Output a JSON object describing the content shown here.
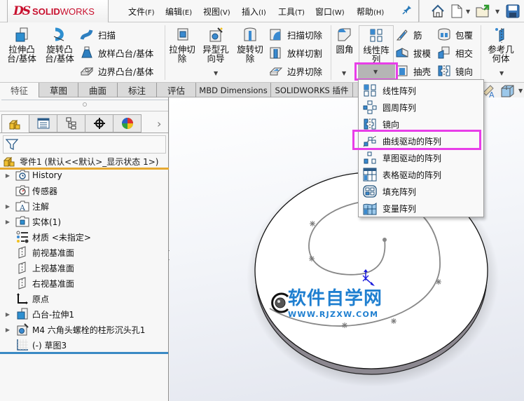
{
  "app": {
    "logo_prefix": "DS",
    "logo_bold": "SOLID",
    "logo_light": "WORKS"
  },
  "menu": [
    {
      "label": "文件",
      "key": "(F)"
    },
    {
      "label": "编辑",
      "key": "(E)"
    },
    {
      "label": "视图",
      "key": "(V)"
    },
    {
      "label": "插入",
      "key": "(I)"
    },
    {
      "label": "工具",
      "key": "(T)"
    },
    {
      "label": "窗口",
      "key": "(W)"
    },
    {
      "label": "帮助",
      "key": "(H)"
    }
  ],
  "quick_access": [
    "home-icon",
    "new-document-icon",
    "open-icon",
    "save-icon"
  ],
  "ribbon": {
    "extrude_boss": "拉伸凸\n台/基体",
    "revolve_boss": "旋转凸\n台/基体",
    "sweep": "扫描",
    "loft_boss": "放样凸台/基体",
    "boundary_boss": "边界凸台/基体",
    "extrude_cut": "拉伸切\n除",
    "hole_wizard": "异型孔\n向导",
    "revolve_cut": "旋转切\n除",
    "sweep_cut": "扫描切除",
    "loft_cut": "放样切割",
    "boundary_cut": "边界切除",
    "fillet": "圆角",
    "linear_pattern": "线性阵\n列",
    "rib": "筋",
    "draft": "拔模",
    "shell": "抽壳",
    "wrap": "包覆",
    "intersect": "相交",
    "mirror": "镜向",
    "reference_geometry": "参考几\n何体"
  },
  "tabs": [
    {
      "label": "特征",
      "active": true
    },
    {
      "label": "草图",
      "active": false
    },
    {
      "label": "曲面",
      "active": false
    },
    {
      "label": "标注",
      "active": false
    },
    {
      "label": "评估",
      "active": false
    },
    {
      "label": "MBD Dimensions",
      "active": false
    },
    {
      "label": "SOLIDWORKS 插件",
      "active": false
    }
  ],
  "panel_tabs": [
    "feature-manager-icon",
    "property-manager-icon",
    "configuration-manager-icon",
    "dimxpert-icon",
    "display-manager-icon"
  ],
  "tree": {
    "root": "零件1  (默认<<默认>_显示状态 1>)",
    "items": [
      {
        "label": "History",
        "expandable": true,
        "icon": "history-folder-icon"
      },
      {
        "label": "传感器",
        "expandable": false,
        "icon": "sensor-folder-icon"
      },
      {
        "label": "注解",
        "expandable": true,
        "icon": "annotation-folder-icon"
      },
      {
        "label": "实体(1)",
        "expandable": true,
        "icon": "solid-bodies-folder-icon"
      },
      {
        "label": "材质 <未指定>",
        "expandable": false,
        "icon": "material-icon"
      },
      {
        "label": "前视基准面",
        "expandable": false,
        "icon": "plane-icon"
      },
      {
        "label": "上视基准面",
        "expandable": false,
        "icon": "plane-icon"
      },
      {
        "label": "右视基准面",
        "expandable": false,
        "icon": "plane-icon"
      },
      {
        "label": "原点",
        "expandable": false,
        "icon": "origin-icon"
      },
      {
        "label": "凸台-拉伸1",
        "expandable": true,
        "icon": "extrude-icon"
      },
      {
        "label": "M4 六角头螺栓的柱形沉头孔1",
        "expandable": true,
        "icon": "hole-wizard-icon"
      },
      {
        "label": "(-) 草图3",
        "expandable": false,
        "icon": "sketch-icon"
      }
    ]
  },
  "dropdown": {
    "items": [
      {
        "label": "线性阵列",
        "icon": "linear-pattern-icon",
        "highlighted": false
      },
      {
        "label": "圆周阵列",
        "icon": "circular-pattern-icon",
        "highlighted": false
      },
      {
        "label": "镜向",
        "icon": "mirror-icon",
        "highlighted": false
      },
      {
        "label": "曲线驱动的阵列",
        "icon": "curve-driven-pattern-icon",
        "highlighted": true
      },
      {
        "label": "草图驱动的阵列",
        "icon": "sketch-driven-pattern-icon",
        "highlighted": false
      },
      {
        "label": "表格驱动的阵列",
        "icon": "table-driven-pattern-icon",
        "highlighted": false
      },
      {
        "label": "填充阵列",
        "icon": "fill-pattern-icon",
        "highlighted": false
      },
      {
        "label": "变量阵列",
        "icon": "variable-pattern-icon",
        "highlighted": false
      }
    ]
  },
  "watermark": {
    "title": "软件自学网",
    "url": "WWW.RJZXW.COM"
  },
  "colors": {
    "highlight": "#e83ee8",
    "root_underline": "#e6a830",
    "tree_bottom": "#3a8ac4",
    "watermark": "#1f7fd0"
  }
}
